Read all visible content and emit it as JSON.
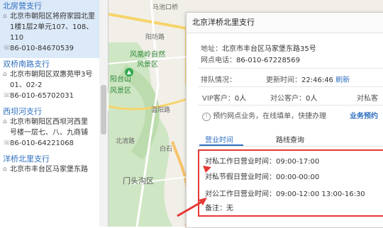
{
  "branches": [
    {
      "name": "北房营支行",
      "address": "北京市朝阳区将府家园北里",
      "address2": "1楼1层2单元107、108、",
      "address3": "110",
      "phone": "86-010-84670539",
      "active": true
    },
    {
      "name": "双桥南路支行",
      "address": "北京市朝阳区双惠苑甲3号",
      "address2": "01、02-2",
      "phone": "86-010-65702031",
      "active": false
    },
    {
      "name": "西坝河支行",
      "address": "北京市朝阳区西坝河西里",
      "address2": "号楼一层七、八、九商铺",
      "phone": "86-010-64221068",
      "active": false
    },
    {
      "name": "洋桥北里支行",
      "address": "北京市丰台区马家堡东路",
      "active": false
    }
  ],
  "map": {
    "labels": [
      "马池口桥",
      "阳坊路",
      "风凰岭自然",
      "风景区",
      "阳台山",
      "风景区",
      "温阳路",
      "北清路",
      "白石",
      "门头沟区"
    ],
    "zoom_pin": "8"
  },
  "popup": {
    "title": "北京洋桥北里支行",
    "address_label": "地址：",
    "address_value": "北京市丰台区马家堡东路35号",
    "phone_label": "网点电话：",
    "phone_value": "86-010-67228569",
    "queue_label": "排队情况：",
    "update_label": "更新时间：",
    "update_value": "22:46:46",
    "refresh": "刷新",
    "vip_label": "VIP客户：",
    "vip_value": "0人",
    "corp_label": "对公客户：",
    "corp_value": "0人",
    "private_label": "对私客",
    "notice": "预约网点业务，在线填单，快捷办理",
    "reserve_link": "业务预约",
    "tabs": [
      "营业时间",
      "路线查询"
    ],
    "hours": [
      "对私工作日营业时间：09:00-17:00",
      "对私节假日营业时间：00:00-00:00",
      "对公工作日营业时间：09:00-12:00   13:00-16:30",
      "备注：无"
    ]
  },
  "colors": {
    "accent": "#2f6fbf",
    "highlight": "#e53935",
    "active_row": "#dbe9f8"
  }
}
